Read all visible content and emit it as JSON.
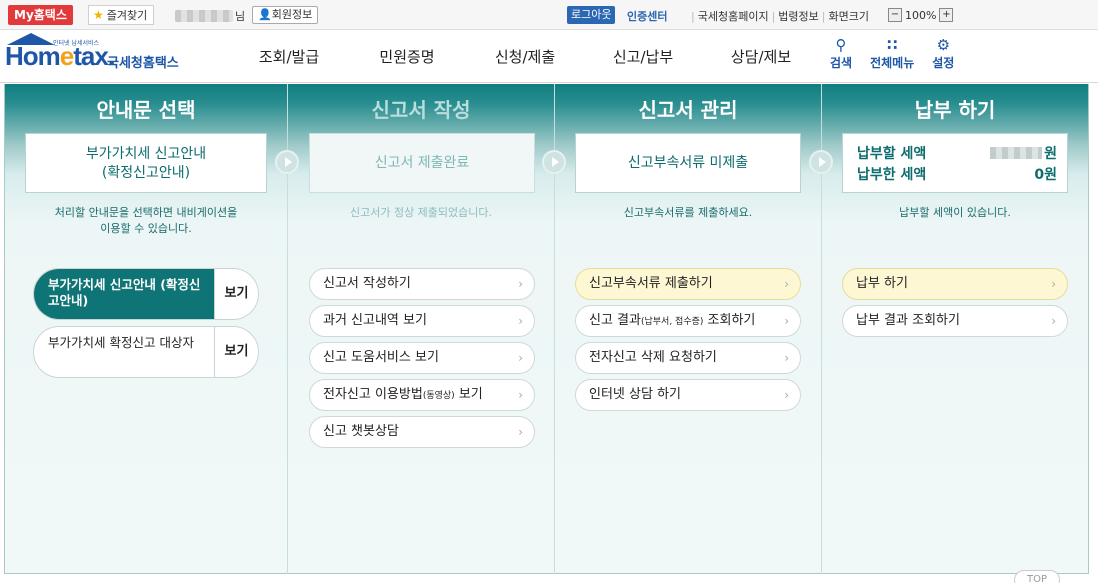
{
  "topbar": {
    "my_home": "My홈택스",
    "favorites": "즐겨찾기",
    "user_suffix": "님",
    "member_info": "회원정보",
    "logout": "로그아웃",
    "cert_center": "인증센터",
    "links": [
      "국세청홈페이지",
      "법령정보",
      "화면크기"
    ],
    "zoom_minus": "−",
    "zoom_value": "100%",
    "zoom_plus": "+"
  },
  "header": {
    "logo_home": "Hom",
    "logo_e": "e",
    "logo_tax": "tax.",
    "logo_sub": "인터넷 납세서비스",
    "logo_kr": "국세청홈택스",
    "nav": [
      "조회/발급",
      "민원증명",
      "신청/제출",
      "신고/납부",
      "상담/제보"
    ],
    "utils": [
      {
        "label": "검색",
        "icon": "search-icon",
        "glyph": "🔍"
      },
      {
        "label": "전체메뉴",
        "icon": "grid-menu-icon",
        "glyph": "⠿"
      },
      {
        "label": "설정",
        "icon": "gear-icon",
        "glyph": "⚙"
      }
    ]
  },
  "columns": {
    "guide": {
      "title": "안내문 선택",
      "status": "부가가치세 신고안내\n(확정신고안내)",
      "desc": "처리할 안내문을 선택하면 내비게이션을\n이용할 수 있습니다.",
      "items": [
        {
          "label": "부가가치세 신고안내 (확정신고안내)",
          "view": "보기",
          "selected": true
        },
        {
          "label": "부가가치세 확정신고 대상자",
          "view": "보기",
          "selected": false
        }
      ]
    },
    "write": {
      "title": "신고서 작성",
      "status": "신고서 제출완료",
      "desc": "신고서가 정상 제출되었습니다.",
      "items": [
        "신고서 작성하기",
        "과거 신고내역 보기",
        "신고 도움서비스 보기",
        "전자신고 이용방법",
        "(동영상)",
        " 보기",
        "신고 챗봇상담"
      ]
    },
    "manage": {
      "title": "신고서 관리",
      "status": "신고부속서류 미제출",
      "desc": "신고부속서류를 제출하세요.",
      "items": [
        "신고부속서류 제출하기",
        "신고 결과",
        "(납부서, 접수증)",
        " 조회하기",
        "전자신고 삭제 요청하기",
        "인터넷 상담 하기"
      ]
    },
    "pay": {
      "title": "납부 하기",
      "to_pay_label": "납부할 세액",
      "to_pay_unit": "원",
      "paid_label": "납부한 세액",
      "paid_value": "0원",
      "desc": "납부할 세액이 있습니다.",
      "items": [
        "납부 하기",
        "납부 결과 조회하기"
      ]
    }
  },
  "footer": {
    "top_button": "TOP"
  }
}
